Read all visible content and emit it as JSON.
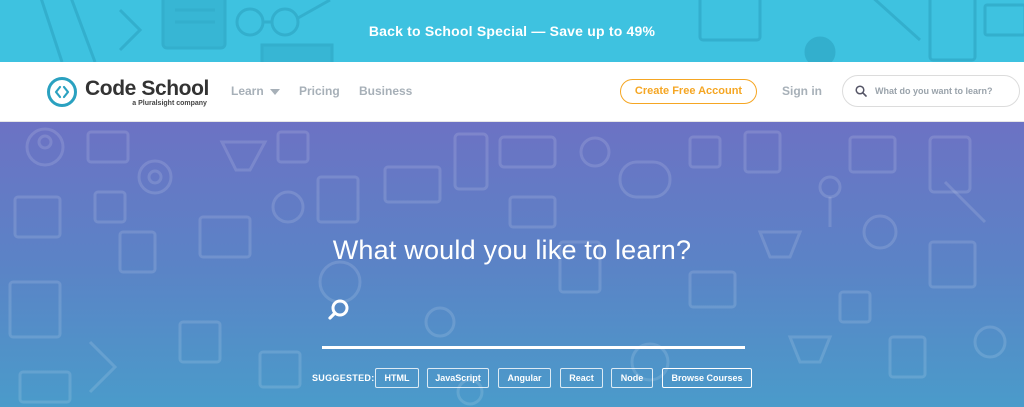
{
  "promo": {
    "text": "Back to School Special — Save up to 49%"
  },
  "brand": {
    "name": "Code School",
    "tagline": "a Pluralsight company",
    "mark_color": "#2aa1c0"
  },
  "nav": {
    "learn": "Learn",
    "pricing": "Pricing",
    "business": "Business",
    "cta": "Create Free Account",
    "signin": "Sign in",
    "search_placeholder": "What do you want to learn?"
  },
  "hero": {
    "title": "What would you like to learn?",
    "search_value": "",
    "suggested_label": "SUGGESTED:",
    "suggestions": [
      "HTML",
      "JavaScript",
      "Angular",
      "React",
      "Node"
    ],
    "browse": "Browse Courses"
  },
  "colors": {
    "promo_bg": "#3ec2e0",
    "accent_orange": "#f5a623",
    "hero_top": "#6c72c4",
    "hero_bottom": "#4a9bca",
    "nav_link": "#a7b0b8"
  }
}
